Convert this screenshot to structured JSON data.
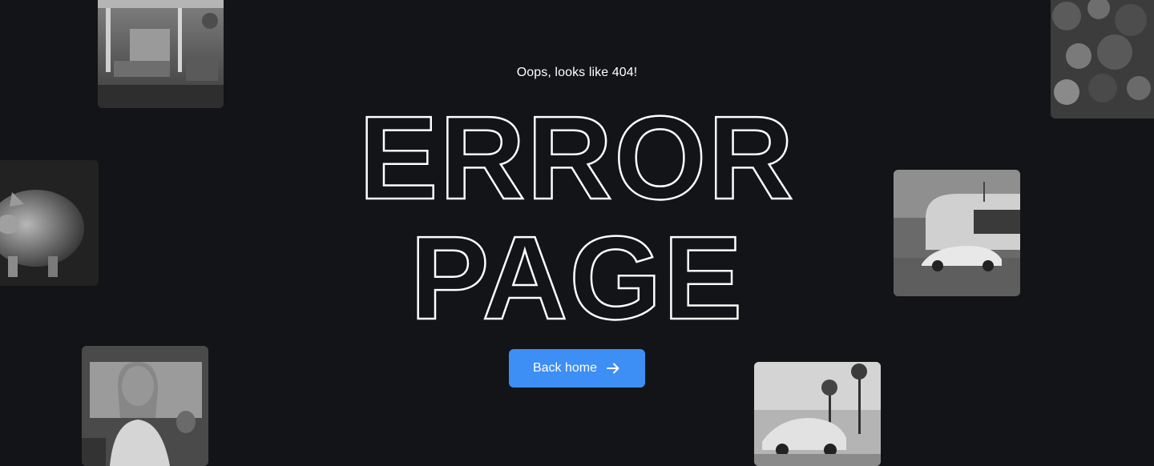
{
  "hero": {
    "subtitle": "Oops, looks like 404!",
    "headline_line1": "ERROR",
    "headline_line2": "PAGE"
  },
  "cta": {
    "label": "Back home",
    "icon": "arrow-right-icon"
  },
  "colors": {
    "background": "#131417",
    "accent": "#3d8ef5",
    "text": "#ffffff"
  }
}
